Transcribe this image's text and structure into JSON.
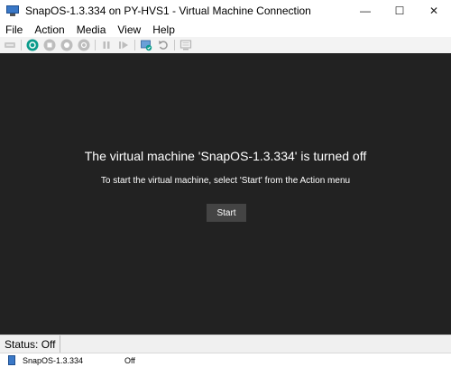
{
  "window": {
    "title": "SnapOS-1.3.334 on PY-HVS1 - Virtual Machine Connection",
    "minimize_glyph": "—",
    "maximize_glyph": "☐",
    "close_glyph": "✕"
  },
  "menu": {
    "items": [
      "File",
      "Action",
      "Media",
      "View",
      "Help"
    ]
  },
  "toolbar": {
    "icons": [
      "ctrl-alt-del-icon",
      "start-icon",
      "turn-off-icon",
      "shutdown-icon",
      "save-icon",
      "pause-icon",
      "resume-icon",
      "checkpoint-icon",
      "revert-icon",
      "enhanced-session-icon"
    ]
  },
  "vm": {
    "heading": "The virtual machine 'SnapOS-1.3.334' is turned off",
    "instruction": "To start the virtual machine, select 'Start' from the Action menu",
    "start_label": "Start"
  },
  "status": {
    "text": "Status: Off"
  },
  "task": {
    "name": "SnapOS-1.3.334",
    "state": "Off"
  },
  "colors": {
    "vm_background": "#222222",
    "start_button": "#444444",
    "accent_green": "#0a9b8b"
  }
}
